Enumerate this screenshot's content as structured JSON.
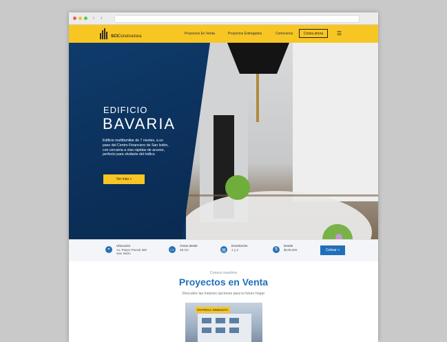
{
  "browser": {
    "back": "‹",
    "forward": "›"
  },
  "nav": {
    "logo_bold": "SCI",
    "logo_rest": "Constructora",
    "links": [
      "Proyectos En Venta",
      "Proyectos Entregados",
      "Conócenos"
    ],
    "cta": "Cotiza ahora",
    "menu_icon": "☰"
  },
  "hero": {
    "eyebrow": "EDIFICIO",
    "title": "BAVARIA",
    "description": "Edificio multifamiliar de 7 niveles, a un paso del Centro Financiero de San Isidro, con cercanía a vías rápidas de acceso, perfecto para olvidarte del tráfico.",
    "button": "Ver más »"
  },
  "info": {
    "items": [
      {
        "icon": "location-icon",
        "glyph": "⌖",
        "label": "Ubicación",
        "line1": "Av. Paseo Parodi 490",
        "line2": "San Isidro"
      },
      {
        "icon": "area-icon",
        "glyph": "▭",
        "label": "Áreas desde",
        "line1": "48 m2",
        "line2": ""
      },
      {
        "icon": "bed-icon",
        "glyph": "▤",
        "label": "Dormitorios",
        "line1": "1 y 2",
        "line2": ""
      },
      {
        "icon": "price-icon",
        "glyph": "$",
        "label": "Desde",
        "line1": "$128,000",
        "line2": ""
      }
    ],
    "button": "Cotizar »"
  },
  "section": {
    "pre": "Conoce nuestros",
    "title": "Proyectos en Venta",
    "subtitle": "Descubre las mejores opciones para tu futuro hogar",
    "card_tag": "ENTREGA INMEDIATA"
  }
}
